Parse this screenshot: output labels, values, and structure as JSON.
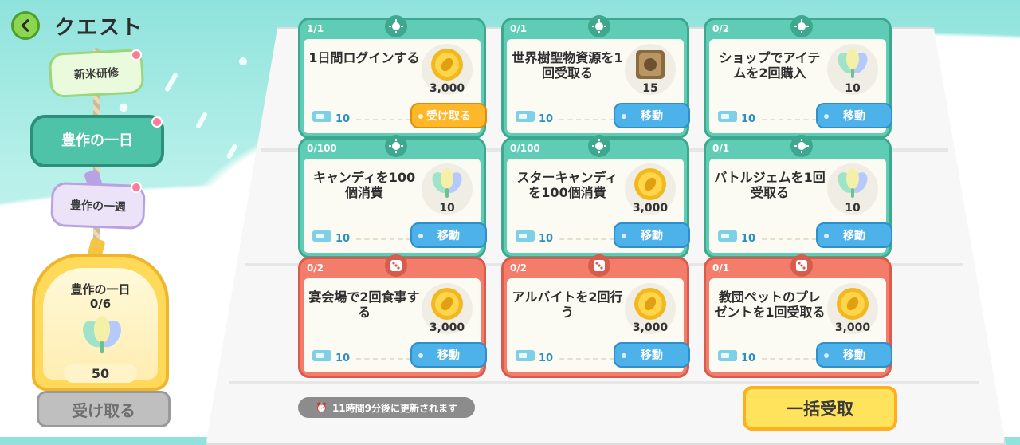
{
  "header": {
    "title": "クエスト"
  },
  "tabs": [
    {
      "label": "新米研修"
    },
    {
      "label": "豊作の一日"
    },
    {
      "label": "豊作の一週"
    }
  ],
  "reward": {
    "title": "豊作の一日",
    "progress": "0/6",
    "count": "50",
    "claim_label": "受け取る",
    "icon": "rainbow-leaf-icon"
  },
  "quests": [
    {
      "progress": "1/1",
      "title": "1日間ログインする",
      "reward_icon": "coin-icon",
      "reward_count": "3,000",
      "xp": "10",
      "button": "受け取る",
      "button_type": "claim",
      "color": "green"
    },
    {
      "progress": "0/1",
      "title": "世界樹聖物資源を1回受取る",
      "reward_icon": "relic-box-icon",
      "reward_count": "15",
      "xp": "10",
      "button": "移動",
      "button_type": "move",
      "color": "green"
    },
    {
      "progress": "0/2",
      "title": "ショップでアイテムを2回購入",
      "reward_icon": "rainbow-leaf-icon",
      "reward_count": "10",
      "xp": "10",
      "button": "移動",
      "button_type": "move",
      "color": "green"
    },
    {
      "progress": "0/100",
      "title": "キャンディを100個消費",
      "reward_icon": "rainbow-leaf-icon",
      "reward_count": "10",
      "xp": "10",
      "button": "移動",
      "button_type": "move",
      "color": "green"
    },
    {
      "progress": "0/100",
      "title": "スターキャンディを100個消費",
      "reward_icon": "coin-icon",
      "reward_count": "3,000",
      "xp": "10",
      "button": "移動",
      "button_type": "move",
      "color": "green"
    },
    {
      "progress": "0/1",
      "title": "バトルジェムを1回受取る",
      "reward_icon": "rainbow-leaf-icon",
      "reward_count": "10",
      "xp": "10",
      "button": "移動",
      "button_type": "move",
      "color": "green"
    },
    {
      "progress": "0/2",
      "title": "宴会場で2回食事する",
      "reward_icon": "coin-icon",
      "reward_count": "3,000",
      "xp": "10",
      "button": "移動",
      "button_type": "move",
      "color": "red"
    },
    {
      "progress": "0/2",
      "title": "アルバイトを2回行う",
      "reward_icon": "coin-icon",
      "reward_count": "3,000",
      "xp": "10",
      "button": "移動",
      "button_type": "move",
      "color": "red"
    },
    {
      "progress": "0/1",
      "title": "教団ペットのプレゼントを1回受取る",
      "reward_icon": "coin-icon",
      "reward_count": "3,000",
      "xp": "10",
      "button": "移動",
      "button_type": "move",
      "color": "red"
    }
  ],
  "footer": {
    "refresh_notice": "11時間9分後に更新されます",
    "claim_all_label": "一括受取"
  },
  "colors": {
    "green": "#5fcdb5",
    "red": "#f47c6b",
    "move": "#4db1ea",
    "claim": "#ffb72a"
  }
}
